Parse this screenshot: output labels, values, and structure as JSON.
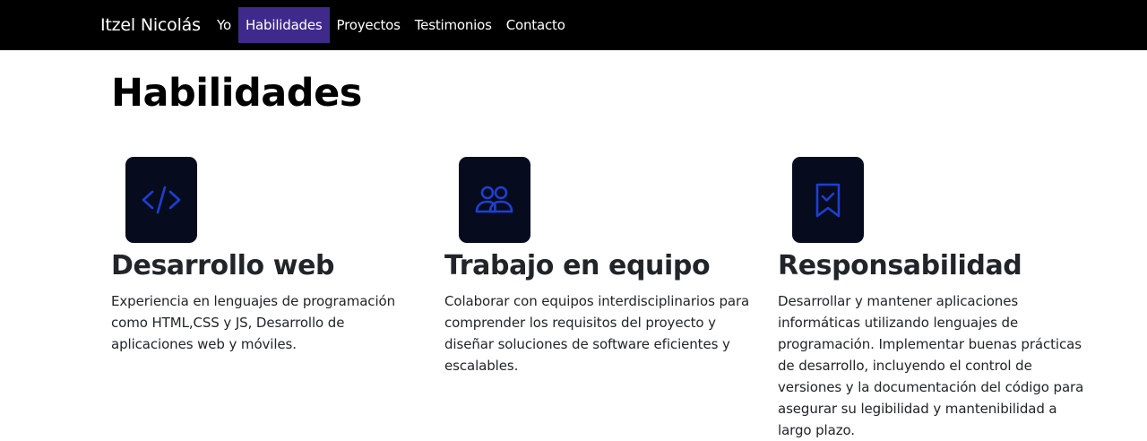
{
  "navbar": {
    "brand": "Itzel Nicolás",
    "links": [
      {
        "label": "Yo",
        "active": false
      },
      {
        "label": "Habilidades",
        "active": true
      },
      {
        "label": "Proyectos",
        "active": false
      },
      {
        "label": "Testimonios",
        "active": false
      },
      {
        "label": "Contacto",
        "active": false
      }
    ],
    "active_color": "#3f2a8c"
  },
  "main": {
    "title": "Habilidades",
    "features": [
      {
        "icon": "code-icon",
        "title": "Desarrollo web",
        "text": "Experiencia en lenguajes de programación como HTML,CSS y JS, Desarrollo de aplicaciones web y móviles."
      },
      {
        "icon": "people-icon",
        "title": "Trabajo en equipo",
        "text": "Colaborar con equipos interdisciplinarios para comprender los requisitos del proyecto y diseñar soluciones de software eficientes y escalables."
      },
      {
        "icon": "bookmark-check-icon",
        "title": "Responsabilidad",
        "text": "Desarrollar y mantener aplicaciones informáticas utilizando lenguajes de programación. Implementar buenas prácticas de desarrollo, incluyendo el control de versiones y la documentación del código para asegurar su legibilidad y mantenibilidad a largo plazo."
      }
    ],
    "icon_bg_color": "#060c1e",
    "icon_color": "#1f3fd1"
  }
}
